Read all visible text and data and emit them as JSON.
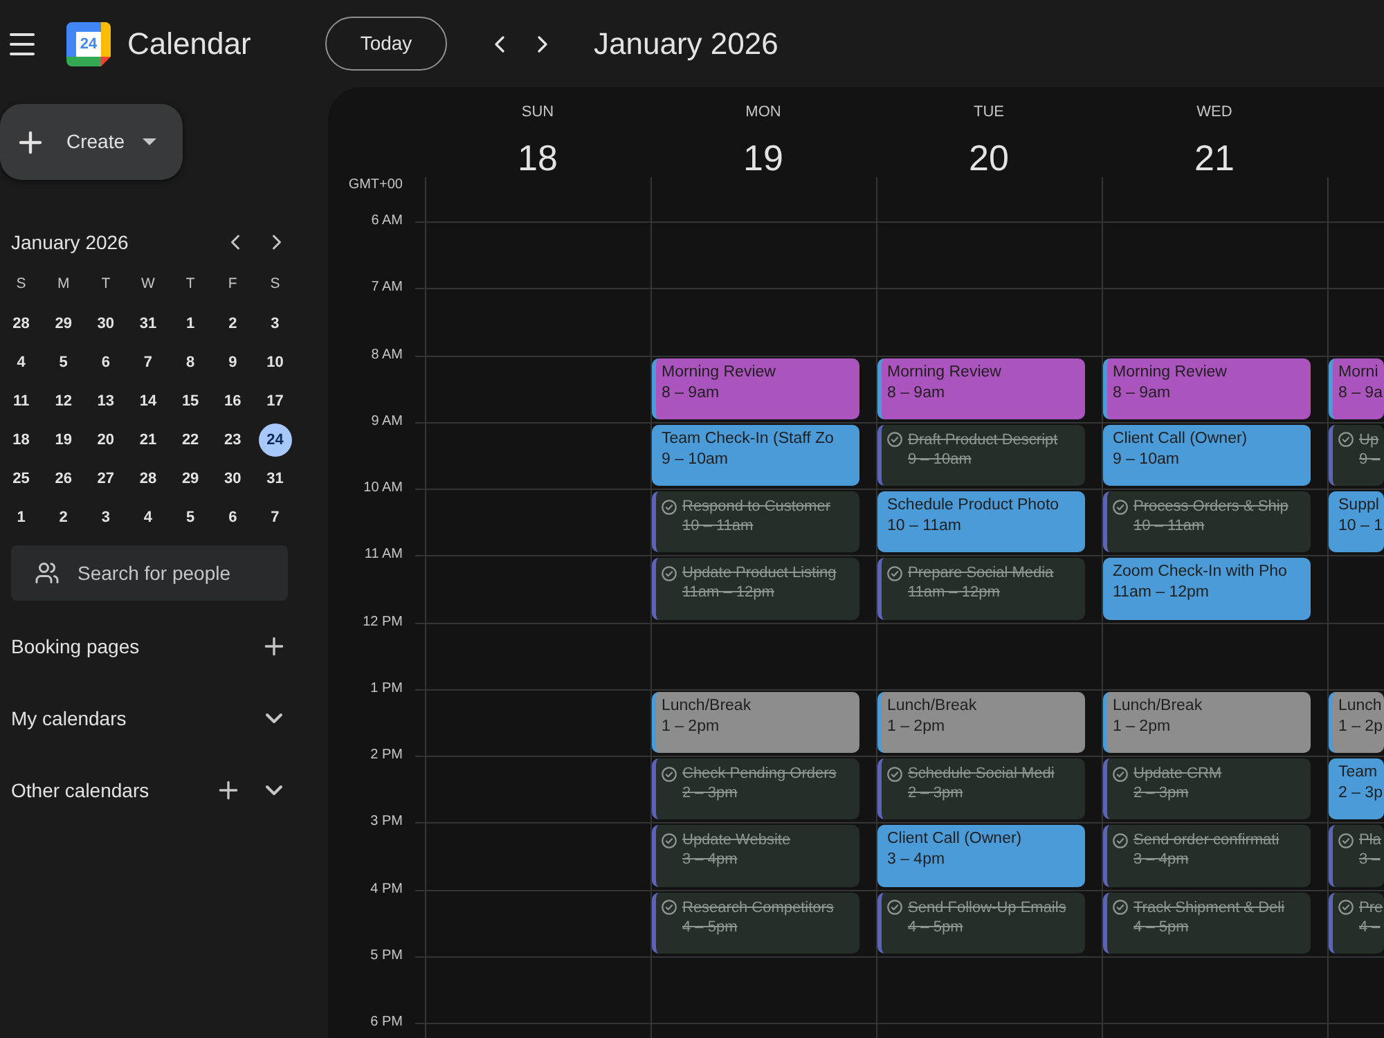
{
  "app": {
    "logo_date": "24",
    "name": "Calendar"
  },
  "toolbar": {
    "today_button": "Today",
    "title": "January 2026"
  },
  "sidebar": {
    "create_button": "Create",
    "mini_calendar": {
      "title": "January 2026",
      "weekdays": [
        "S",
        "M",
        "T",
        "W",
        "T",
        "F",
        "S"
      ],
      "weeks": [
        [
          {
            "day": "28",
            "selected": false
          },
          {
            "day": "29",
            "selected": false
          },
          {
            "day": "30",
            "selected": false
          },
          {
            "day": "31",
            "selected": false
          },
          {
            "day": "1",
            "selected": false
          },
          {
            "day": "2",
            "selected": false
          },
          {
            "day": "3",
            "selected": false
          }
        ],
        [
          {
            "day": "4",
            "selected": false
          },
          {
            "day": "5",
            "selected": false
          },
          {
            "day": "6",
            "selected": false
          },
          {
            "day": "7",
            "selected": false
          },
          {
            "day": "8",
            "selected": false
          },
          {
            "day": "9",
            "selected": false
          },
          {
            "day": "10",
            "selected": false
          }
        ],
        [
          {
            "day": "11",
            "selected": false
          },
          {
            "day": "12",
            "selected": false
          },
          {
            "day": "13",
            "selected": false
          },
          {
            "day": "14",
            "selected": false
          },
          {
            "day": "15",
            "selected": false
          },
          {
            "day": "16",
            "selected": false
          },
          {
            "day": "17",
            "selected": false
          }
        ],
        [
          {
            "day": "18",
            "selected": false
          },
          {
            "day": "19",
            "selected": false
          },
          {
            "day": "20",
            "selected": false
          },
          {
            "day": "21",
            "selected": false
          },
          {
            "day": "22",
            "selected": false
          },
          {
            "day": "23",
            "selected": false
          },
          {
            "day": "24",
            "selected": true
          }
        ],
        [
          {
            "day": "25",
            "selected": false
          },
          {
            "day": "26",
            "selected": false
          },
          {
            "day": "27",
            "selected": false
          },
          {
            "day": "28",
            "selected": false
          },
          {
            "day": "29",
            "selected": false
          },
          {
            "day": "30",
            "selected": false
          },
          {
            "day": "31",
            "selected": false
          }
        ],
        [
          {
            "day": "1",
            "selected": false
          },
          {
            "day": "2",
            "selected": false
          },
          {
            "day": "3",
            "selected": false
          },
          {
            "day": "4",
            "selected": false
          },
          {
            "day": "5",
            "selected": false
          },
          {
            "day": "6",
            "selected": false
          },
          {
            "day": "7",
            "selected": false
          }
        ]
      ]
    },
    "search": {
      "placeholder": "Search for people"
    },
    "sections": [
      {
        "label": "Booking pages",
        "add_button": true,
        "toggle_button": false
      },
      {
        "label": "My calendars",
        "add_button": false,
        "toggle_button": true
      },
      {
        "label": "Other calendars",
        "add_button": true,
        "toggle_button": true
      }
    ]
  },
  "week_view": {
    "timezone": "GMT+00",
    "hours": [
      "6 AM",
      "7 AM",
      "8 AM",
      "9 AM",
      "10 AM",
      "11 AM",
      "12 PM",
      "1 PM",
      "2 PM",
      "3 PM",
      "4 PM",
      "5 PM",
      "6 PM"
    ],
    "days": [
      {
        "weekday": "SUN",
        "date": "18"
      },
      {
        "weekday": "MON",
        "date": "19",
        "cells": [
          {
            "kind": "empty"
          },
          {
            "kind": "empty"
          },
          {
            "kind": "event",
            "title": "Morning Review",
            "time": "8 – 9am",
            "color": "#ab54bd"
          },
          {
            "kind": "event",
            "title": "Team Check-In (Staff Zo",
            "time": "9 – 10am",
            "color": "#4a9bd8"
          },
          {
            "kind": "task",
            "title": "Respond to Customer",
            "time": "10 – 11am",
            "done": true
          },
          {
            "kind": "task",
            "title": "Update Product Listing",
            "time": "11am – 12pm",
            "done": true
          },
          {
            "kind": "empty"
          },
          {
            "kind": "event",
            "title": "Lunch/Break",
            "time": "1 – 2pm",
            "color": "#8d8d8d"
          },
          {
            "kind": "task",
            "title": "Check Pending Orders",
            "time": "2 – 3pm",
            "done": true
          },
          {
            "kind": "task",
            "title": "Update Website",
            "time": "3 – 4pm",
            "done": true
          },
          {
            "kind": "task",
            "title": "Research Competitors",
            "time": "4 – 5pm",
            "done": true
          }
        ]
      },
      {
        "weekday": "TUE",
        "date": "20",
        "cells": [
          {
            "kind": "empty"
          },
          {
            "kind": "empty"
          },
          {
            "kind": "event",
            "title": "Morning Review",
            "time": "8 – 9am",
            "color": "#ab54bd"
          },
          {
            "kind": "task",
            "title": "Draft Product Descript",
            "time": "9 – 10am",
            "done": true
          },
          {
            "kind": "event",
            "title": "Schedule Product Photo",
            "time": "10 – 11am",
            "color": "#4a9bd8"
          },
          {
            "kind": "task",
            "title": "Prepare Social Media",
            "time": "11am – 12pm",
            "done": true
          },
          {
            "kind": "empty"
          },
          {
            "kind": "event",
            "title": "Lunch/Break",
            "time": "1 – 2pm",
            "color": "#8d8d8d"
          },
          {
            "kind": "task",
            "title": "Schedule Social Medi",
            "time": "2 – 3pm",
            "done": true
          },
          {
            "kind": "event",
            "title": "Client Call (Owner)",
            "time": "3 – 4pm",
            "color": "#4a9bd8"
          },
          {
            "kind": "task",
            "title": "Send Follow-Up Emails",
            "time": "4 – 5pm",
            "done": true
          }
        ]
      },
      {
        "weekday": "WED",
        "date": "21",
        "cells": [
          {
            "kind": "empty"
          },
          {
            "kind": "empty"
          },
          {
            "kind": "event",
            "title": "Morning Review",
            "time": "8 – 9am",
            "color": "#ab54bd"
          },
          {
            "kind": "event",
            "title": "Client Call (Owner)",
            "time": "9 – 10am",
            "color": "#4a9bd8"
          },
          {
            "kind": "task",
            "title": "Process Orders & Ship",
            "time": "10 – 11am",
            "done": true
          },
          {
            "kind": "event",
            "title": "Zoom Check-In with Pho",
            "time": "11am – 12pm",
            "color": "#4a9bd8"
          },
          {
            "kind": "empty"
          },
          {
            "kind": "event",
            "title": "Lunch/Break",
            "time": "1 – 2pm",
            "color": "#8d8d8d"
          },
          {
            "kind": "task",
            "title": "Update CRM",
            "time": "2 – 3pm",
            "done": true
          },
          {
            "kind": "task",
            "title": "Send order confirmati",
            "time": "3 – 4pm",
            "done": true
          },
          {
            "kind": "task",
            "title": "Track Shipment & Deli",
            "time": "4 – 5pm",
            "done": true
          }
        ]
      },
      {
        "cells": [
          {
            "kind": "empty"
          },
          {
            "kind": "empty"
          },
          {
            "kind": "event",
            "title": "Morni",
            "time": "8 – 9a",
            "color": "#ab54bd"
          },
          {
            "kind": "task",
            "title": "Up",
            "time": "9 –",
            "done": true
          },
          {
            "kind": "event",
            "title": "Suppl",
            "time": "10 – 1",
            "color": "#4a9bd8"
          },
          {
            "kind": "empty"
          },
          {
            "kind": "empty"
          },
          {
            "kind": "event",
            "title": "Lunch",
            "time": "1 – 2p",
            "color": "#8d8d8d"
          },
          {
            "kind": "event",
            "title": "Team",
            "time": "2 – 3p",
            "color": "#4a9bd8"
          },
          {
            "kind": "task",
            "title": "Pla",
            "time": "3 –",
            "done": true
          },
          {
            "kind": "task",
            "title": "Pre",
            "time": "4 –",
            "done": true
          }
        ]
      }
    ]
  }
}
